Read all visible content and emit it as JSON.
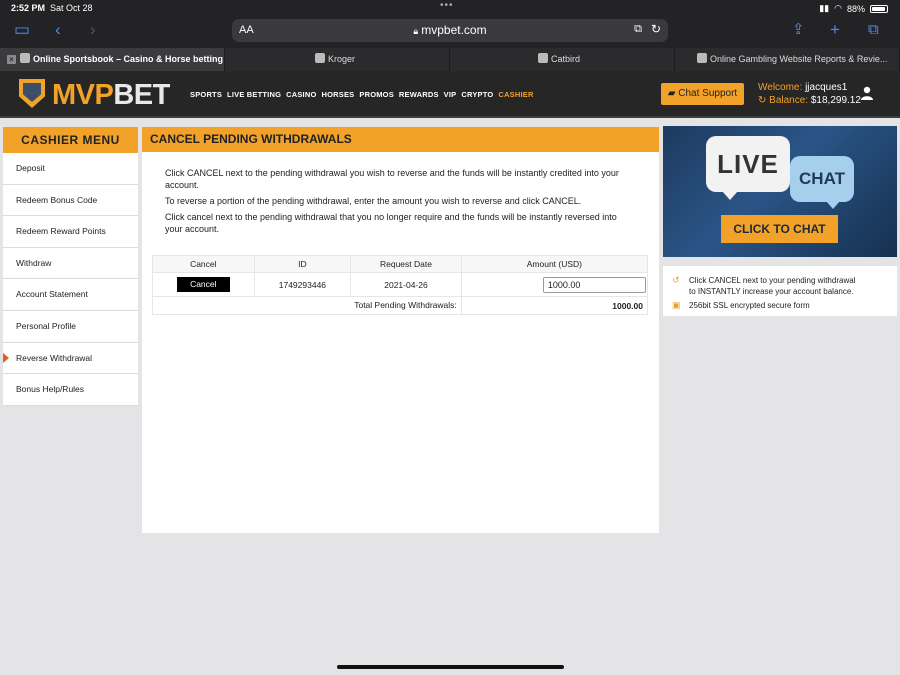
{
  "status": {
    "time": "2:52 PM",
    "date": "Sat Oct 28",
    "battery": "88%"
  },
  "browser": {
    "reader_label": "AA",
    "url": "mvpbet.com"
  },
  "tabs": [
    {
      "label": "Online Sportsbook – Casino & Horse betting",
      "active": true
    },
    {
      "label": "Kroger",
      "active": false
    },
    {
      "label": "Catbird",
      "active": false
    },
    {
      "label": "Online Gambling Website Reports & Revie...",
      "active": false
    }
  ],
  "site": {
    "logo_mvp": "MVP",
    "logo_bet": "BET",
    "nav": [
      "SPORTS",
      "LIVE BETTING",
      "CASINO",
      "HORSES",
      "PROMOS",
      "REWARDS",
      "VIP",
      "CRYPTO",
      "CASHIER"
    ],
    "chat_support": "Chat Support",
    "welcome_label": "Welcome:",
    "username": "jjacques1",
    "balance_label": "Balance:",
    "balance": "$18,299.12"
  },
  "sidebar": {
    "title": "CASHIER MENU",
    "items": [
      "Deposit",
      "Redeem Bonus Code",
      "Redeem Reward Points",
      "Withdraw",
      "Account Statement",
      "Personal Profile",
      "Reverse Withdrawal",
      "Bonus Help/Rules"
    ],
    "active": "Reverse Withdrawal"
  },
  "main": {
    "title": "CANCEL PENDING WITHDRAWALS",
    "intro": [
      "Click CANCEL next to the pending withdrawal you wish to reverse and the funds will be instantly credited into your account.",
      "To reverse a portion of the pending withdrawal, enter the amount you wish to reverse and click CANCEL.",
      "Click cancel next to the pending withdrawal that you no longer require and the funds will be instantly reversed into your account."
    ],
    "table": {
      "headers": [
        "Cancel",
        "ID",
        "Request Date",
        "Amount (USD)"
      ],
      "row": {
        "cancel_label": "Cancel",
        "id": "1749293446",
        "date": "2021-04-26",
        "amount": "1000.00"
      },
      "total_label": "Total Pending Withdrawals:",
      "total_value": "1000.00"
    }
  },
  "banner": {
    "live": "LIVE",
    "chat": "CHAT",
    "button": "CLICK TO CHAT"
  },
  "info": {
    "line1": "Click CANCEL next to your pending withdrawal",
    "line2": "to INSTANTLY increase your account balance.",
    "line3": "256bit SSL encrypted secure form"
  }
}
